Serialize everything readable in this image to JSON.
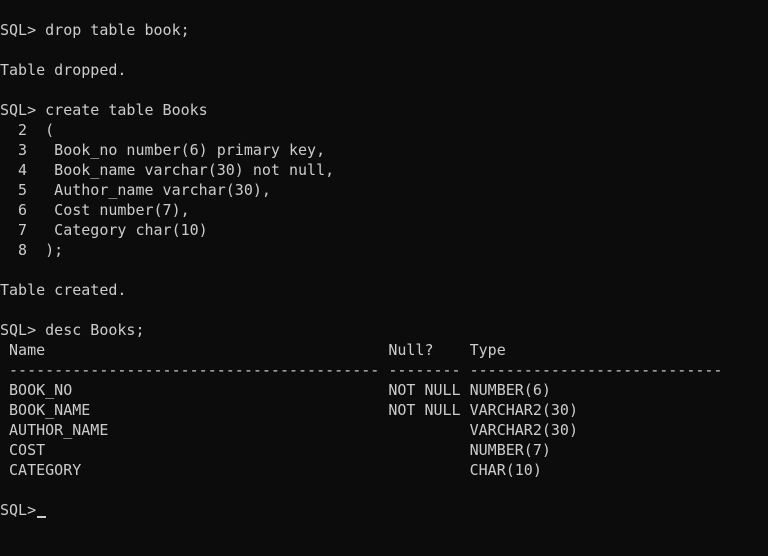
{
  "terminal": {
    "prompt": "SQL> ",
    "blocks": {
      "drop_command": "drop table book;",
      "drop_result": "Table dropped.",
      "create_command": "create table Books",
      "create_lines": [
        "  2  (",
        "  3   Book_no number(6) primary key,",
        "  4   Book_name varchar(30) not null,",
        "  5   Author_name varchar(30),",
        "  6   Cost number(7),",
        "  7   Category char(10)",
        "  8  );"
      ],
      "create_result": "Table created.",
      "desc_command": "desc Books;",
      "desc_table": {
        "header": " Name                                      Null?    Type",
        "separator": " ----------------------------------------- -------- ----------------------------",
        "rows": [
          " BOOK_NO                                   NOT NULL NUMBER(6)",
          " BOOK_NAME                                 NOT NULL VARCHAR2(30)",
          " AUTHOR_NAME                                        VARCHAR2(30)",
          " COST                                               NUMBER(7)",
          " CATEGORY                                           CHAR(10)"
        ]
      },
      "final_prompt": "SQL>"
    }
  }
}
